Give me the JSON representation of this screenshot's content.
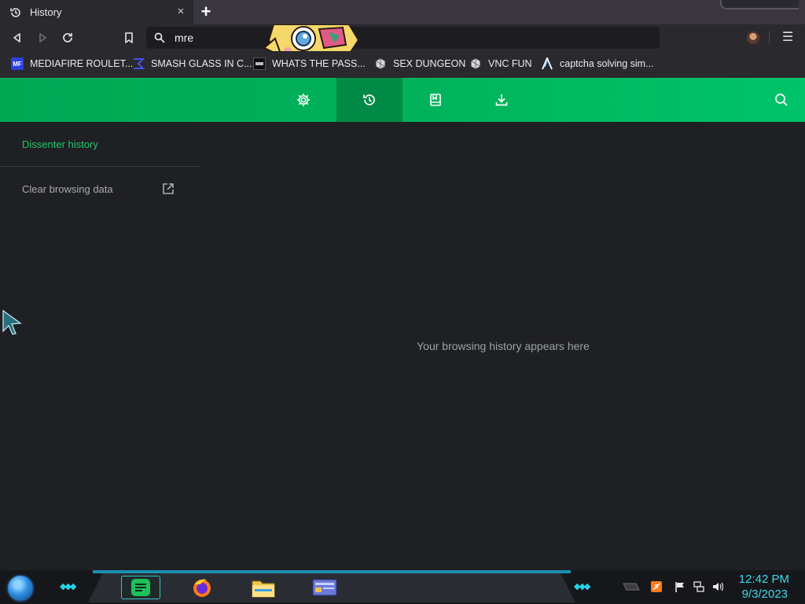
{
  "browser": {
    "tab": {
      "title": "History",
      "close_glyph": "×",
      "icon": "history-icon"
    },
    "new_tab_glyph": "+",
    "address": {
      "value": "mre",
      "icon": "search-icon"
    },
    "menu_glyph": "☰"
  },
  "bookmarks": [
    {
      "label": "MEDIAFIRE ROULET...",
      "favicon": "MF",
      "color": "#2c3fd8"
    },
    {
      "label": "SMASH GLASS IN C...",
      "favicon": "Σ",
      "color": "#3a3ad8"
    },
    {
      "label": "WHATS THE PASS...",
      "favicon": "▬",
      "color": "#111111"
    },
    {
      "label": "SEX DUNGEON",
      "favicon": "◆",
      "color": "#cfcfcf"
    },
    {
      "label": "VNC FUN",
      "favicon": "◆",
      "color": "#cfcfcf"
    },
    {
      "label": "captcha solving sim...",
      "favicon": "Λ",
      "color": "#1a1a1a"
    }
  ],
  "nav": {
    "tabs": [
      {
        "name": "settings",
        "icon": "gear-icon"
      },
      {
        "name": "history",
        "icon": "history-icon",
        "active": true
      },
      {
        "name": "bookmarks",
        "icon": "bookmark-icon"
      },
      {
        "name": "downloads",
        "icon": "download-icon"
      }
    ],
    "search_icon": "search-icon",
    "accent": "#00b05a"
  },
  "sidebar": {
    "title": "Dissenter history",
    "clear_label": "Clear browsing data"
  },
  "main": {
    "empty_message": "Your browsing history appears here"
  },
  "taskbar": {
    "time": "12:42 PM",
    "date": "9/3/2023",
    "accent": "#3fd8e8"
  }
}
